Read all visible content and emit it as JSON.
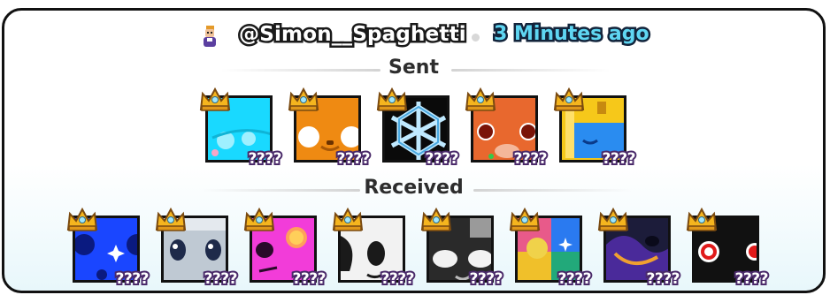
{
  "header": {
    "avatar_icon": "roblox-avatar-icon",
    "username": "@Simon__Spaghetti",
    "time": "3 Minutes ago"
  },
  "sections": {
    "sent_title": "Sent",
    "received_title": "Received"
  },
  "sent": [
    {
      "name": "cyan-pet",
      "qty": "????",
      "color": "#19d9ff"
    },
    {
      "name": "orange-fox-pet",
      "qty": "????",
      "color": "#ef8a12"
    },
    {
      "name": "snowflake-pet",
      "qty": "????",
      "color": "#0a0a0a"
    },
    {
      "name": "red-cat-pet",
      "qty": "????",
      "color": "#e8682e"
    },
    {
      "name": "yellow-box-pet",
      "qty": "????",
      "color": "#f6c81a"
    }
  ],
  "received": [
    {
      "name": "blue-cat-pet",
      "qty": "????",
      "color": "#1a46ff"
    },
    {
      "name": "gray-cat-pet",
      "qty": "????",
      "color": "#bfc9d3"
    },
    {
      "name": "pink-pet",
      "qty": "????",
      "color": "#f23cd9"
    },
    {
      "name": "white-pet",
      "qty": "????",
      "color": "#f2f2f2"
    },
    {
      "name": "black-white-pet",
      "qty": "????",
      "color": "#3a3a3a"
    },
    {
      "name": "rainbow-pet",
      "qty": "????",
      "color": "#22a97a"
    },
    {
      "name": "dark-galaxy-pet",
      "qty": "????",
      "color": "#1c1c3a"
    },
    {
      "name": "red-swirl-pet",
      "qty": "????",
      "color": "#111111"
    }
  ]
}
